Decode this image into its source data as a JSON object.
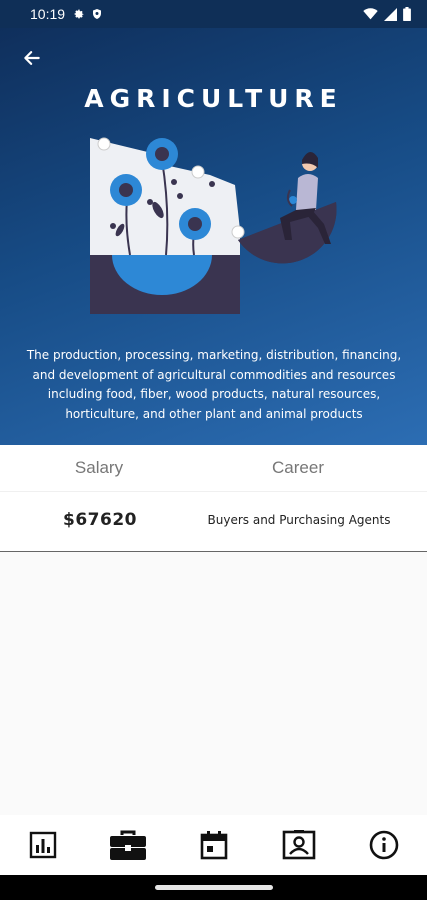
{
  "status_bar": {
    "time": "10:19",
    "icons_left": [
      "gear-icon",
      "shield-icon"
    ],
    "icons_right": [
      "wifi-icon",
      "signal-icon",
      "battery-icon"
    ]
  },
  "header": {
    "back_icon": "arrow-left-icon",
    "title": "AGRICULTURE",
    "description": "The production, processing, marketing, distribution, financing, and development of agricultural commodities and resources including food, fiber, wood products, natural resources, horticulture, and other plant and animal products"
  },
  "table": {
    "headers": {
      "salary": "Salary",
      "career": "Career"
    },
    "rows": [
      {
        "salary": "$67620",
        "career": "Buyers and Purchasing Agents"
      }
    ]
  },
  "bottom_nav": {
    "items": [
      {
        "icon": "bar-chart-icon"
      },
      {
        "icon": "briefcase-icon",
        "active": true
      },
      {
        "icon": "calendar-icon"
      },
      {
        "icon": "contact-card-icon"
      },
      {
        "icon": "info-icon"
      }
    ]
  },
  "colors": {
    "hero_gradient_start": "#0f2f5c",
    "hero_gradient_end": "#2c6db3",
    "accent_blue": "#2d88d6",
    "illustration_dark": "#3a3450"
  }
}
